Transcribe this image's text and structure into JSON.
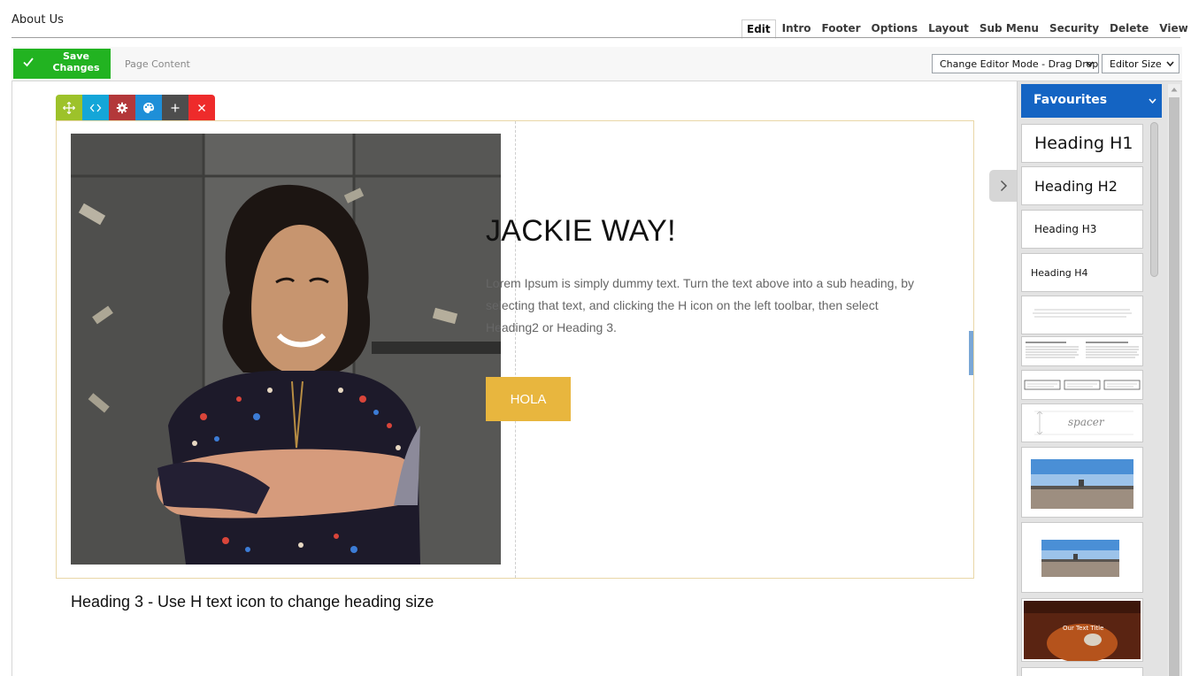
{
  "header": {
    "page_title": "About Us",
    "tabs": [
      {
        "label": "Edit",
        "active": true
      },
      {
        "label": "Intro"
      },
      {
        "label": "Footer"
      },
      {
        "label": "Options"
      },
      {
        "label": "Layout"
      },
      {
        "label": "Sub Menu"
      },
      {
        "label": "Security"
      },
      {
        "label": "Delete"
      },
      {
        "label": "View"
      }
    ]
  },
  "toolbar": {
    "save_label": "Save Changes",
    "page_content_label": "Page Content",
    "editor_mode_select": "Change Editor Mode - Drag Drop",
    "editor_size_select": "Editor Size"
  },
  "row_tools": [
    {
      "icon": "move-icon",
      "color": "#9dc22a"
    },
    {
      "icon": "code-icon",
      "color": "#14a6d8"
    },
    {
      "icon": "gear-icon",
      "color": "#b3383a"
    },
    {
      "icon": "palette-icon",
      "color": "#1e8fd8"
    },
    {
      "icon": "plus-icon",
      "color": "#4d4d4d"
    },
    {
      "icon": "close-icon",
      "color": "#ee2b2b"
    }
  ],
  "content": {
    "heading": "JACKIE WAY!",
    "paragraph": "Lorem Ipsum is simply dummy text. Turn the text above into a sub heading, by selecting that text, and clicking the H icon on the left toolbar, then select Heading2 or Heading 3.",
    "button_label": "HOLA",
    "sub_heading": "Heading 3 - Use H text icon to change heading size"
  },
  "panel": {
    "category": "Favourites",
    "snippets": [
      {
        "label": "Heading H1"
      },
      {
        "label": "Heading H2"
      },
      {
        "label": "Heading H3"
      },
      {
        "label": "Heading H4"
      },
      {
        "label": "spacer"
      },
      {
        "label": "Our Text Title"
      }
    ]
  },
  "colors": {
    "save_green": "#22b321",
    "favourites_blue": "#1464c3",
    "hola_gold": "#e8b63e",
    "block_border": "#e9d7a7"
  }
}
